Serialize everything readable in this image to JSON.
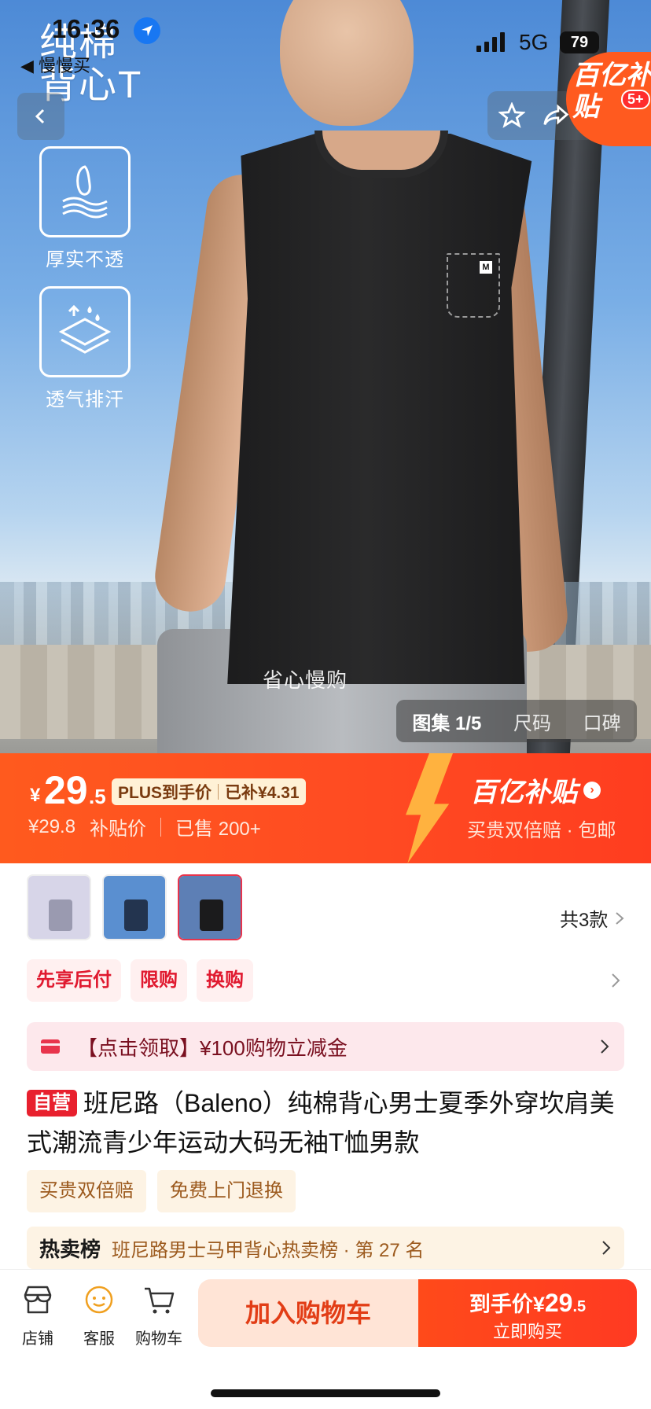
{
  "status_bar": {
    "time": "16:36",
    "back_app": "◀ 慢慢买",
    "network": "5G",
    "battery": "79"
  },
  "hero": {
    "title_line1": "纯棉",
    "title_line2": "背心T",
    "features": [
      {
        "label": "厚实不透",
        "icon": "fabric-thick-icon"
      },
      {
        "label": "透气排汗",
        "icon": "breathable-icon"
      }
    ],
    "watermark": "省心慢购",
    "gallery_tabs": [
      {
        "label": "图集 1/5",
        "active": true
      },
      {
        "label": "尺码",
        "active": false
      },
      {
        "label": "口碑",
        "active": false
      }
    ],
    "subsidy_badge": {
      "text": "百亿补贴",
      "count": "5+"
    }
  },
  "price": {
    "currency": "¥",
    "integer": "29",
    "decimal": ".5",
    "plus_label": "PLUS到手价",
    "subsidized": "已补¥4.31",
    "original": "¥29.8",
    "original_label": "补贴价",
    "sold": "已售 200+",
    "subsidy_title": "百亿补贴",
    "subsidy_desc": "买贵双倍赔 · 包邮"
  },
  "variants": {
    "count_label": "共3款",
    "items": [
      {
        "color": "#d7d5e8",
        "shirt": "#9a9ab0",
        "selected": false
      },
      {
        "color": "#5a8fd0",
        "shirt": "#23344f",
        "selected": false
      },
      {
        "color": "#5d7fb5",
        "shirt": "#1b1b1c",
        "selected": true
      }
    ]
  },
  "tags": [
    "先享后付",
    "限购",
    "换购"
  ],
  "coupon": {
    "text": "【点击领取】¥100购物立减金"
  },
  "product": {
    "badge": "自营",
    "title": "班尼路（Baleno）纯棉背心男士夏季外穿坎肩美式潮流青少年运动大码无袖T恤男款"
  },
  "service_tags": [
    "买贵双倍赔",
    "免费上门退换"
  ],
  "rank": {
    "label": "热卖榜",
    "text": "班尼路男士马甲背心热卖榜 · 第 27 名"
  },
  "bottom_bar": {
    "shop": "店铺",
    "service": "客服",
    "cart": "购物车",
    "add_cart": "加入购物车",
    "buy_prefix": "到手价¥",
    "buy_price_int": "29",
    "buy_price_dec": ".5",
    "buy_now": "立即购买"
  },
  "colors": {
    "accent_red": "#e8202e",
    "banner_orange": "#ff4b22",
    "tag_bg": "#fff0f0"
  }
}
